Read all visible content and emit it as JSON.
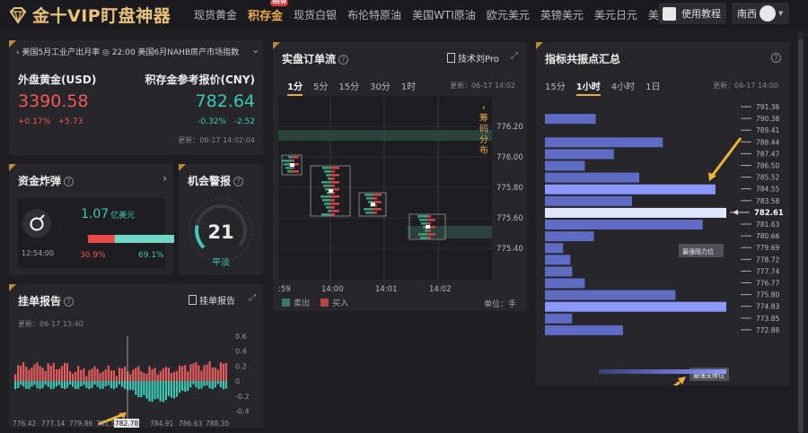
{
  "app": {
    "title": "金十VIP盯盘神器"
  },
  "nav": {
    "tabs": [
      "现货黄金",
      "积存金",
      "现货白银",
      "布伦特原油",
      "美国WTI原油",
      "欧元美元",
      "英镑美元",
      "美元日元",
      "美"
    ],
    "active_index": 1,
    "new_badge": "NEW"
  },
  "header": {
    "tutorial_label": "使用教程",
    "user_name": "南西"
  },
  "ticker": {
    "text": "› 美国5月工业产出月率 ◎ 22:00 美国6月NAHB房产市场指数",
    "gold_name": "外盘黄金(USD)",
    "gold_price": "3390.58",
    "gold_pct": "+0.17%",
    "gold_chg": "+5.73",
    "cny_name": "积存金参考报价(CNY)",
    "cny_price": "782.64",
    "cny_pct": "-0.32%",
    "cny_chg": "-2.52",
    "updated": "更新：06-17 14:02:04"
  },
  "bomb": {
    "title": "资金炸弹",
    "amount": "1.07",
    "unit": "亿美元",
    "time": "12:54:00",
    "sell_pct": "30.9%",
    "buy_pct": "69.1%",
    "sell_share": 0.309
  },
  "alert": {
    "title": "机会警报",
    "value": "21",
    "status": "平淡",
    "level": 0.21
  },
  "report": {
    "title": "挂单报告",
    "link": "挂单报告",
    "updated": "更新：06-17 13:40",
    "y_ticks": [
      "0.6",
      "0.4",
      "0.2",
      "0",
      "-0.2",
      "-0.4"
    ],
    "x_ticks": [
      "776.42",
      "777.14",
      "779.86",
      "781.5",
      "782.78",
      "784.91",
      "786.63",
      "788.35"
    ]
  },
  "orderflow": {
    "title": "实盘订单流",
    "pro_label": "技术刘Pro",
    "tabs": [
      "1分",
      "5分",
      "15分",
      "30分",
      "1时"
    ],
    "active_tab": 0,
    "updated": "更新：06-17 14:02",
    "side_label": "筹码分布",
    "price_ticks": [
      "776.20",
      "776.00",
      "775.80",
      "775.60",
      "775.40"
    ],
    "time_ticks": [
      ":59",
      "14:00",
      "14:01",
      "14:02"
    ],
    "legend_sell": "卖出",
    "legend_buy": "买入",
    "unit": "单位：手"
  },
  "pivots": {
    "title": "指标共振点汇总",
    "tabs": [
      "15分",
      "1小时",
      "4小时",
      "1日"
    ],
    "active_tab": 1,
    "updated": "更新：06-17 14:00",
    "levels": [
      "791.36",
      "790.38",
      "789.41",
      "788.44",
      "787.47",
      "786.50",
      "785.52",
      "784.55",
      "783.58",
      "782.61",
      "781.63",
      "780.66",
      "779.69",
      "778.72",
      "777.74",
      "776.77",
      "775.80",
      "774.83",
      "773.85",
      "772.88"
    ],
    "current": "782.61",
    "strengths": [
      0,
      0.28,
      0,
      0.65,
      0.38,
      0.22,
      0.52,
      0.94,
      0.48,
      1.0,
      0.87,
      0.27,
      0.1,
      0.14,
      0.15,
      0.22,
      0.72,
      1.0,
      0.15,
      0.43
    ],
    "resistance_label": "最强阻力位",
    "support_label": "最强支撑位",
    "weak_label": "弱",
    "strong_label": "强"
  },
  "colors": {
    "accent": "#e9a847",
    "up": "#f05a5a",
    "down": "#3ec9b4",
    "bar_blue": "#5f6cc4",
    "bar_bright": "#8a97ff"
  }
}
